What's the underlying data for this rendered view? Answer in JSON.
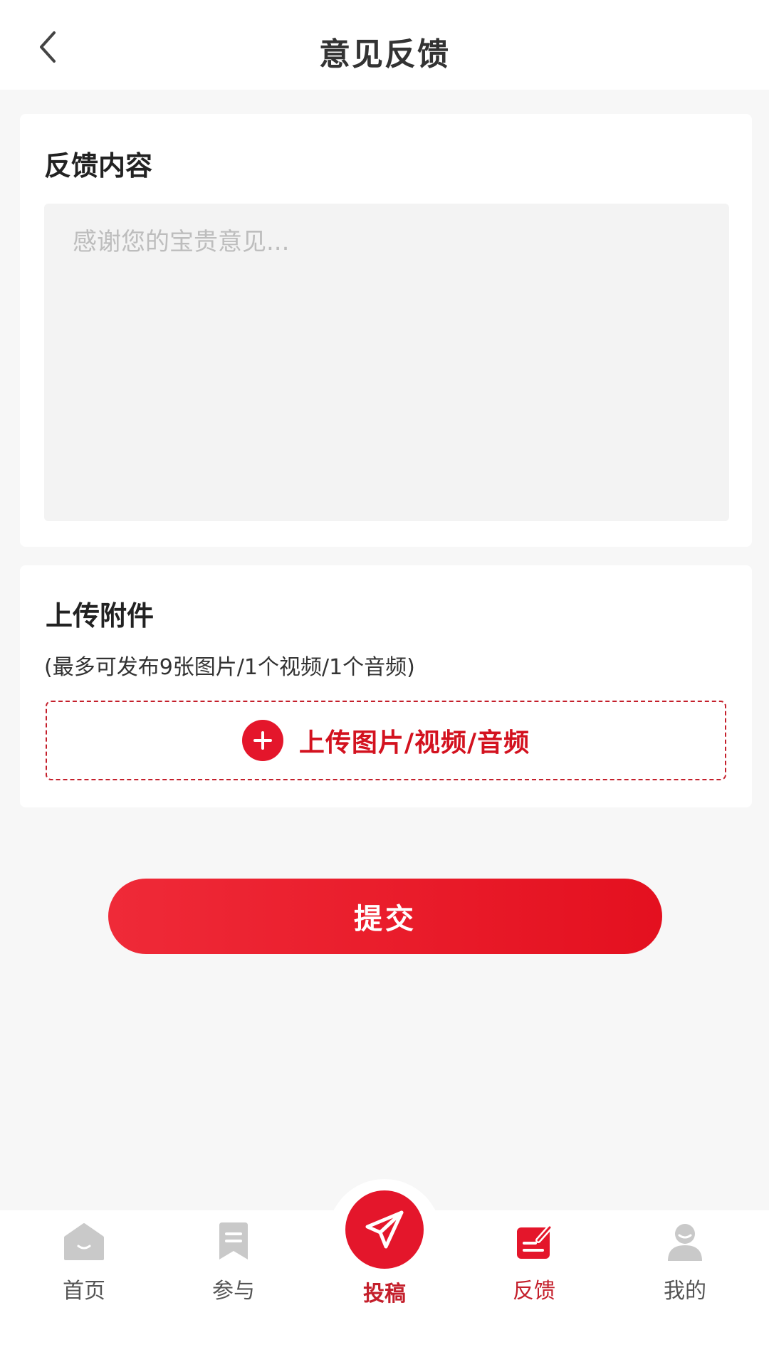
{
  "header": {
    "title": "意见反馈",
    "back_icon": "chevron-left-icon"
  },
  "feedback": {
    "title": "反馈内容",
    "placeholder": "感谢您的宝贵意见...",
    "value": ""
  },
  "attachments": {
    "title": "上传附件",
    "hint": "(最多可发布9张图片/1个视频/1个音频)",
    "upload_label": "上传图片/视频/音频",
    "upload_icon": "plus-circle-icon"
  },
  "submit": {
    "label": "提交"
  },
  "tabbar": {
    "items": [
      {
        "label": "首页",
        "icon": "home-icon",
        "active": false
      },
      {
        "label": "参与",
        "icon": "bookmark-icon",
        "active": false
      },
      {
        "label": "投稿",
        "icon": "paper-plane-icon",
        "active": false
      },
      {
        "label": "反馈",
        "icon": "feedback-edit-icon",
        "active": true
      },
      {
        "label": "我的",
        "icon": "user-icon",
        "active": false
      }
    ]
  },
  "colors": {
    "accent": "#e4162b",
    "accent_dark": "#c41f2b",
    "background": "#f7f7f7",
    "input_bg": "#f3f3f3",
    "inactive_icon": "#c9c9c9"
  }
}
